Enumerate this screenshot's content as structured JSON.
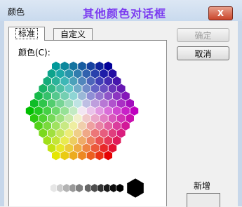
{
  "window": {
    "title": "颜色",
    "caption": "其他颜色对话框",
    "close_glyph": "X"
  },
  "tabs": [
    {
      "label": "标准",
      "selected": true
    },
    {
      "label": "自定义",
      "selected": false
    }
  ],
  "colors_label": "颜色(C):",
  "buttons": {
    "ok": "确定",
    "cancel": "取消"
  },
  "new_label": "新增",
  "accent_colors": {
    "caption": "#7c3cf0",
    "close_button": "#c9452b",
    "selected_swatch": "#000000"
  }
}
